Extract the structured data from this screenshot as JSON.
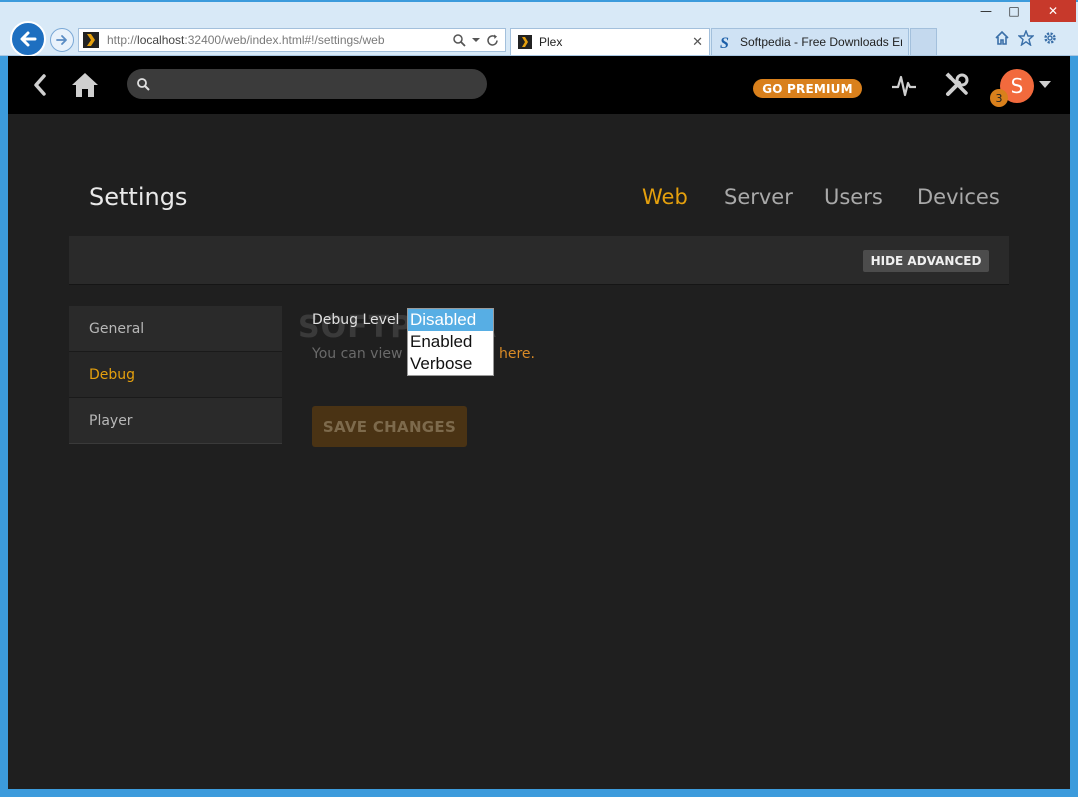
{
  "browser": {
    "url_prefix": "http://",
    "url_host": "localhost",
    "url_rest": ":32400/web/index.html#!/settings/web",
    "tabs": [
      {
        "label": "Plex",
        "active": true
      },
      {
        "label": "Softpedia - Free Downloads En...",
        "active": false
      }
    ],
    "close_glyph": "✕",
    "minimize_glyph": "—",
    "maximize_glyph": "□"
  },
  "topbar": {
    "search": {
      "placeholder": "",
      "value": ""
    },
    "premium_label": "GO PREMIUM",
    "avatar_letter": "S",
    "notification_count": "3"
  },
  "settings": {
    "title": "Settings",
    "tabs": [
      {
        "label": "Web",
        "active": true
      },
      {
        "label": "Server",
        "active": false
      },
      {
        "label": "Users",
        "active": false
      },
      {
        "label": "Devices",
        "active": false
      }
    ],
    "hide_advanced_label": "HIDE ADVANCED",
    "sidenav": [
      {
        "label": "General",
        "active": false
      },
      {
        "label": "Debug",
        "active": true
      },
      {
        "label": "Player",
        "active": false
      }
    ]
  },
  "debug": {
    "label": "Debug Level",
    "options": [
      "Disabled",
      "Enabled",
      "Verbose"
    ],
    "selected": "Disabled",
    "help_prefix": "You can view t",
    "help_link": "here.",
    "save_label": "SAVE CHANGES"
  },
  "watermark": "SOFTPEDIA",
  "colors": {
    "accent": "#e5a00d",
    "premium": "#d9801c",
    "avatar": "#f26a3d",
    "background": "#1f1f1f"
  }
}
